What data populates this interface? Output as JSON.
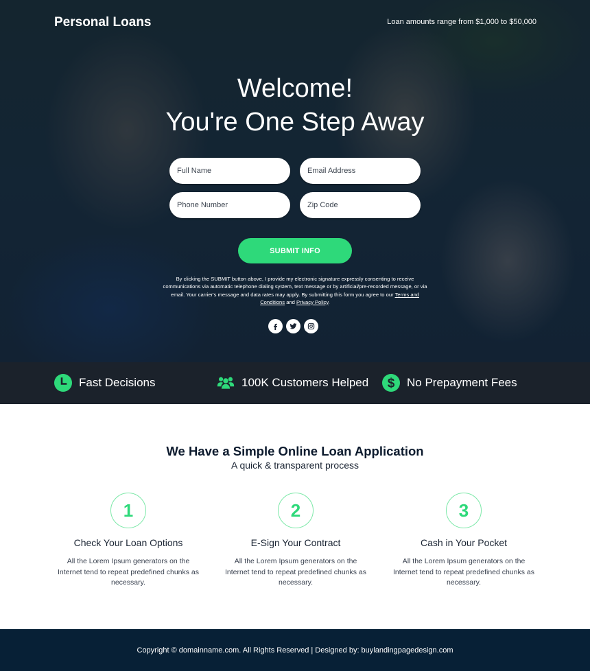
{
  "header": {
    "brand": "Personal Loans",
    "range_text": "Loan amounts range from $1,000 to $50,000"
  },
  "hero": {
    "headline_line1": "Welcome!",
    "headline_line2": "You're One Step Away"
  },
  "form": {
    "full_name": {
      "placeholder": "Full Name",
      "value": ""
    },
    "email": {
      "placeholder": "Email Address",
      "value": ""
    },
    "phone": {
      "placeholder": "Phone Number",
      "value": ""
    },
    "zip": {
      "placeholder": "Zip Code",
      "value": ""
    },
    "submit_label": "SUBMIT INFO"
  },
  "disclaimer": {
    "text": "By clicking the SUBMIT button above, I provide my electronic signature expressly consenting to receive communications via automatic telephone dialing system, text message or by artificial/pre-recorded message, or via email. Your carrier's message and data rates may apply. By submitting this form you agree to our ",
    "terms_link": "Terms and Conditions",
    "and_text": " and ",
    "privacy_link": "Privacy Policy",
    "end": "."
  },
  "social": [
    {
      "icon": "facebook-icon"
    },
    {
      "icon": "twitter-icon"
    },
    {
      "icon": "instagram-icon"
    }
  ],
  "features": [
    {
      "icon": "clock-icon",
      "label": "Fast Decisions"
    },
    {
      "icon": "users-icon",
      "label": "100K Customers Helped"
    },
    {
      "icon": "dollar-icon",
      "label": "No Prepayment Fees"
    }
  ],
  "process": {
    "title": "We Have a Simple Online Loan Application",
    "subtitle": "A quick & transparent process",
    "steps": [
      {
        "number": "1",
        "title": "Check Your Loan Options",
        "text": "All the Lorem Ipsum generators on the Internet tend to repeat predefined chunks as necessary."
      },
      {
        "number": "2",
        "title": "E-Sign Your Contract",
        "text": "All the Lorem Ipsum generators on the Internet tend to repeat predefined chunks as necessary."
      },
      {
        "number": "3",
        "title": "Cash in Your Pocket",
        "text": "All the Lorem Ipsum generators on the Internet tend to repeat predefined chunks as necessary."
      }
    ]
  },
  "footer": {
    "copyright": "Copyright © domainname.com. All Rights Reserved | Designed by: buylandingpagedesign.com"
  },
  "colors": {
    "accent_green": "#2ed97a",
    "footer_bg": "#072036",
    "heading_dark": "#0d1b2e"
  }
}
